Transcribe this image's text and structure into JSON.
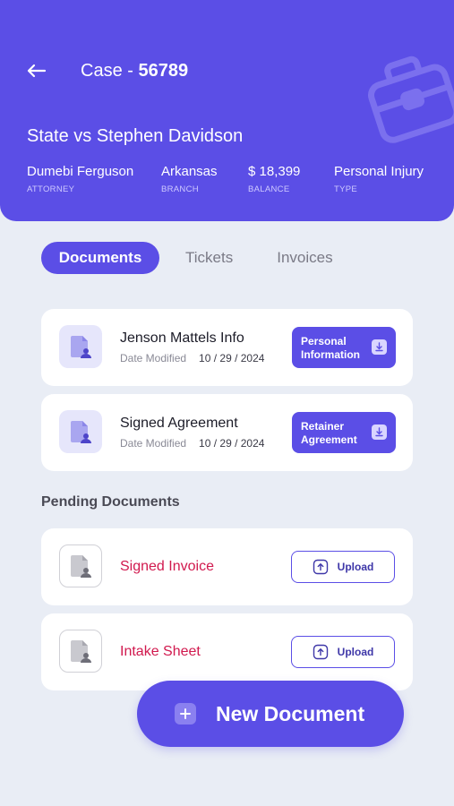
{
  "header": {
    "case_prefix": "Case - ",
    "case_number": "56789",
    "case_name": "State vs Stephen Davidson",
    "meta": [
      {
        "value": "Dumebi Ferguson",
        "label": "ATTORNEY"
      },
      {
        "value": "Arkansas",
        "label": "BRANCH"
      },
      {
        "value": "$ 18,399",
        "label": "BALANCE"
      },
      {
        "value": "Personal Injury",
        "label": "TYPE"
      }
    ]
  },
  "tabs": [
    {
      "label": "Documents",
      "active": true
    },
    {
      "label": "Tickets",
      "active": false
    },
    {
      "label": "Invoices",
      "active": false
    }
  ],
  "documents": [
    {
      "title": "Jenson Mattels Info",
      "date_label": "Date Modified",
      "date": "10 / 29 / 2024",
      "tag": "Personal Information",
      "icon": "document-user-icon"
    },
    {
      "title": "Signed Agreement",
      "date_label": "Date Modified",
      "date": "10 / 29 / 2024",
      "tag": "Retainer Agreement",
      "icon": "document-user-icon"
    }
  ],
  "pending": {
    "title": "Pending Documents",
    "items": [
      {
        "title": "Signed Invoice",
        "action": "Upload"
      },
      {
        "title": "Intake Sheet",
        "action": "Upload"
      }
    ]
  },
  "fab": {
    "label": "New Document",
    "icon": "plus-icon"
  },
  "colors": {
    "accent": "#5b4ee6",
    "background": "#e9edf5",
    "pending_text": "#d1194e"
  }
}
